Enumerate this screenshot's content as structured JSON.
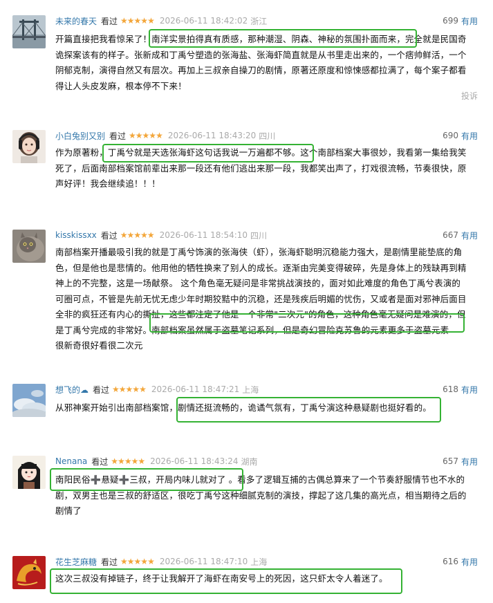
{
  "labels": {
    "watched": "看过",
    "useful": "有用",
    "report": "投诉"
  },
  "highlight_color": "#34b233",
  "star_color": "#f3a63a",
  "link_color": "#3377aa",
  "comments": [
    {
      "username": "未来的春天",
      "rating_stars": 5,
      "rating_text": "★★★★★",
      "time": "2026-06-11 18:42:02",
      "location": "浙江",
      "useful_count": "699",
      "avatar": "bridge-photo",
      "lines": [
        "开篇直接把我看惊呆了！南洋实景拍得真有质感，那种潮湿、阴森、神秘的氛围扑面而来，完全就是民国奇",
        "诡探案该有的样子。张新成和丁禹兮塑造的张海盐、张海虾简直就是从书里走出来的，一个痞帅鲜活，一个",
        "阴郁克制，演得自然又有层次。再加上三叔亲自操刀的剧情，原著还原度和惊悚感都拉满了，每个案子都看",
        "得让人头皮发麻，根本停不下来！"
      ],
      "highlight": "南洋实景拍得真有质感，那种潮湿、阴森、神秘的氛围扑面而来，"
    },
    {
      "username": "小白兔别又别",
      "rating_stars": 5,
      "rating_text": "★★★★★",
      "time": "2026-06-11 18:43:20",
      "location": "四川",
      "useful_count": "690",
      "avatar": "girl-portrait",
      "lines": [
        "作为原著粉，丁禹兮就是天选张海虾这句话我说一万遍都不够。这个南部档案大事很妙，我看第一集给我笑",
        "死了，后面南部档案馆前辈出来那一段还有他们逃出来那一段，我都笑出声了，打戏很流畅，节奏很快，原",
        "声好评！我会继续追！！！"
      ],
      "highlight": "丁禹兮就是天选张海虾这句话我说一万遍都不够。"
    },
    {
      "username": "kisskissxx",
      "rating_stars": 5,
      "rating_text": "★★★★★",
      "time": "2026-06-11 18:54:10",
      "location": "四川",
      "useful_count": "667",
      "avatar": "cat-photo",
      "lines": [
        "南部档案开播最吸引我的就是丁禹兮饰演的张海侠（虾），张海虾聪明沉稳能力强大，是剧情里能垫底的角",
        "色，但是他也是悲情的。他用他的牺牲换来了别人的成长。逐渐由完美变得破碎，先是身体上的残缺再到精",
        "神上的不完整，这是一场献祭。 这个角色毫无疑问是非常挑战演技的，面对如此难度的角色丁禹兮表演的",
        "可圈可点，不管是先前无忧无虑少年时期狡黠中的沉稳，还是残疾后明媚的忧伤，又或者是面对邪神后面目",
        "全非的疯狂还有内心的撕扯，这些都注定了他是一个非常\"二次元\"的角色，这种角色毫无疑问是难演的，但",
        "是丁禹兮完成的非常好。南部档案虽然属于盗墓笔记系列，但是奇幻冒险克苏鲁的元素更多于盗墓元素",
        "很新奇很好看很二次元"
      ],
      "highlight": "南部档案虽然属于盗墓笔记系列，但是奇幻冒险克苏鲁的元素更多于盗墓元素"
    },
    {
      "username": "想飞的☁",
      "rating_stars": 5,
      "rating_text": "★★★★★",
      "time": "2026-06-11 18:47:21",
      "location": "上海",
      "useful_count": "618",
      "avatar": "sky-photo",
      "lines": [
        "从邪神案开始引出南部档案馆，剧情还挺流畅的，诡谲气氛有，丁禹兮演这种悬疑剧也挺好看的。"
      ],
      "highlight": "剧情还挺流畅的，诡谲气氛有，丁禹兮演这种悬疑剧也挺好看的。"
    },
    {
      "username": "Nenana",
      "rating_stars": 5,
      "rating_text": "★★★★★",
      "time": "2026-06-11 18:43:24",
      "location": "湖南",
      "useful_count": "657",
      "avatar": "cartoon-girl",
      "lines": [
        "南阳民俗➕悬疑➕三叔，开局内味儿就对了 。看多了逻辑互捕的古偶总算来了一个节奏舒服情节也不水的",
        "剧，双男主也是三叔的舒适区，很吃丁禹兮这种细腻克制的演技，撑起了这几集的高光点，相当期待之后的",
        "剧情了"
      ],
      "highlight": "南阳民俗➕悬疑➕三叔，开局内味儿就对了 。"
    },
    {
      "username": "花生芝麻糖",
      "rating_stars": 5,
      "rating_text": "★★★★★",
      "time": "2026-06-11 18:47:10",
      "location": "上海",
      "useful_count": "616",
      "avatar": "red-dragon",
      "lines": [
        "这次三叔没有掉链子，终于让我解开了海虾在南安号上的死因，这只虾太令人着迷了。"
      ],
      "highlight": "这次三叔没有掉链子，终于让我解开了海虾在南安号上的死因，这只虾太令人着迷了。"
    }
  ]
}
